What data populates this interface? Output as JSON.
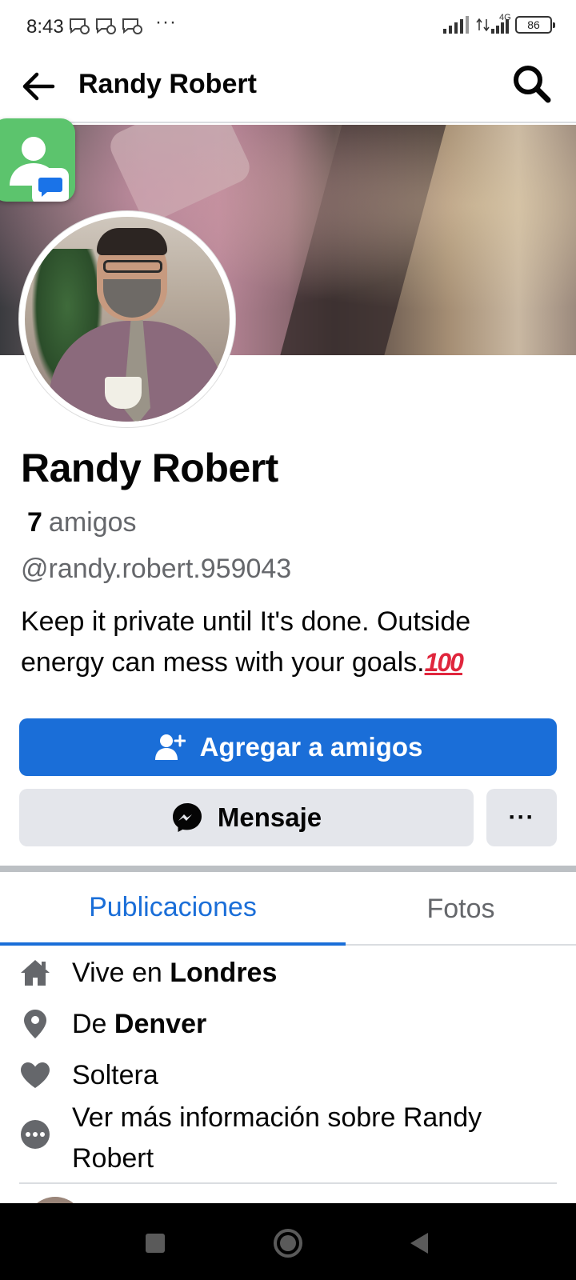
{
  "status_bar": {
    "time": "8:43",
    "dots": "···",
    "network": "4G",
    "battery": "86"
  },
  "header": {
    "title": "Randy Robert"
  },
  "profile": {
    "name": "Randy Robert",
    "friends_count": "7",
    "friends_label": "amigos",
    "username": "@randy.robert.959043",
    "bio": "Keep it private until It's done. Outside energy can mess with your goals.",
    "bio_emoji": "100"
  },
  "actions": {
    "add_friend": "Agregar a amigos",
    "message": "Mensaje",
    "more": "···"
  },
  "tabs": [
    {
      "label": "Publicaciones",
      "active": true
    },
    {
      "label": "Fotos",
      "active": false
    }
  ],
  "details": {
    "lives_prefix": "Vive en",
    "lives_city": "Londres",
    "from_prefix": "De",
    "from_city": "Denver",
    "relationship": "Soltera",
    "more_info": "Ver más información sobre Randy Robert"
  },
  "icons": {
    "back": "arrow-left-icon",
    "search": "search-icon",
    "add_friend": "person-add-icon",
    "messenger": "messenger-icon",
    "home": "home-icon",
    "location": "location-pin-icon",
    "heart": "heart-icon",
    "more": "more-dots-icon"
  },
  "colors": {
    "accent": "#1a6ed8",
    "secondary_button": "#e4e6eb",
    "muted_text": "#65676b",
    "bubble_green": "#5cc46d"
  }
}
